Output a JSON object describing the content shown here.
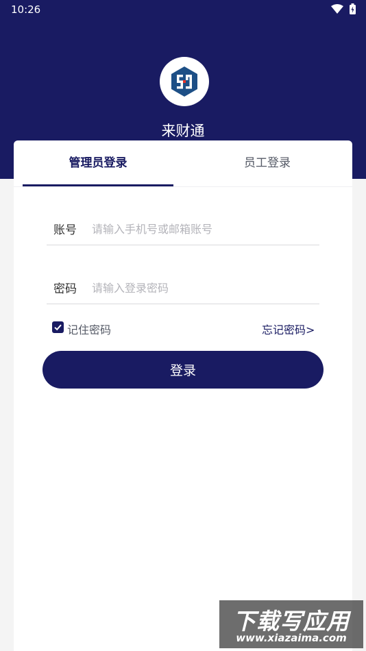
{
  "status_bar": {
    "time": "10:26",
    "wifi_icon": "wifi-icon",
    "battery_icon": "battery-icon"
  },
  "header": {
    "logo_icon": "app-logo-icon",
    "app_name": "来财通",
    "background": "#191b62"
  },
  "tabs": [
    {
      "label": "管理员登录",
      "active": true
    },
    {
      "label": "员工登录",
      "active": false
    }
  ],
  "form": {
    "account": {
      "label": "账号",
      "value": "",
      "placeholder": "请输入手机号或邮箱账号"
    },
    "password": {
      "label": "密码",
      "value": "",
      "placeholder": "请输入登录密码"
    },
    "remember": {
      "label": "记住密码",
      "checked": true
    },
    "forgot_label": "忘记密码>",
    "login_label": "登录"
  },
  "watermark": {
    "title": "下载写应用",
    "url": "www.xiazaima.com"
  },
  "colors": {
    "primary": "#191b62",
    "accent": "#e7332a",
    "page_bg": "#f4f4f4"
  }
}
